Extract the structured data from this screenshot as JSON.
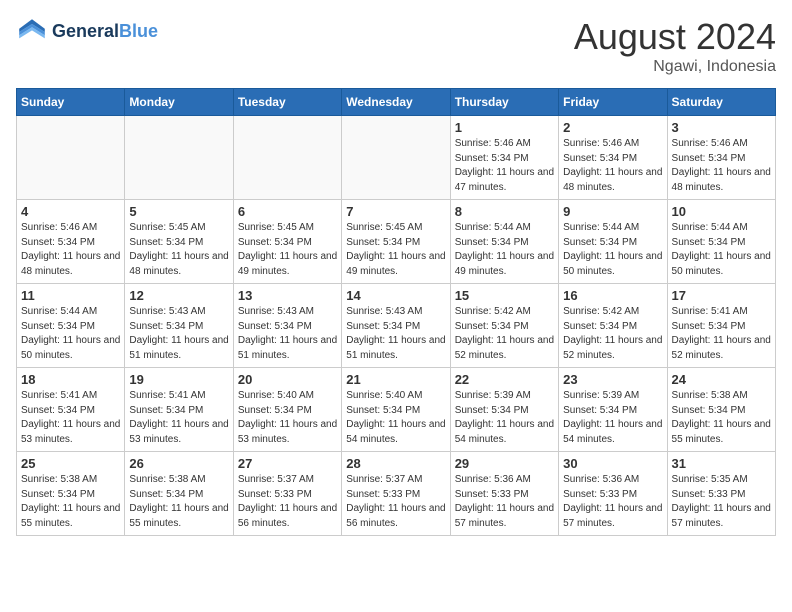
{
  "header": {
    "logo_line1": "General",
    "logo_line2": "Blue",
    "month_year": "August 2024",
    "location": "Ngawi, Indonesia"
  },
  "weekdays": [
    "Sunday",
    "Monday",
    "Tuesday",
    "Wednesday",
    "Thursday",
    "Friday",
    "Saturday"
  ],
  "weeks": [
    [
      {
        "day": "",
        "empty": true
      },
      {
        "day": "",
        "empty": true
      },
      {
        "day": "",
        "empty": true
      },
      {
        "day": "",
        "empty": true
      },
      {
        "day": "1",
        "sunrise": "5:46 AM",
        "sunset": "5:34 PM",
        "daylight": "11 hours and 47 minutes."
      },
      {
        "day": "2",
        "sunrise": "5:46 AM",
        "sunset": "5:34 PM",
        "daylight": "11 hours and 48 minutes."
      },
      {
        "day": "3",
        "sunrise": "5:46 AM",
        "sunset": "5:34 PM",
        "daylight": "11 hours and 48 minutes."
      }
    ],
    [
      {
        "day": "4",
        "sunrise": "5:46 AM",
        "sunset": "5:34 PM",
        "daylight": "11 hours and 48 minutes."
      },
      {
        "day": "5",
        "sunrise": "5:45 AM",
        "sunset": "5:34 PM",
        "daylight": "11 hours and 48 minutes."
      },
      {
        "day": "6",
        "sunrise": "5:45 AM",
        "sunset": "5:34 PM",
        "daylight": "11 hours and 49 minutes."
      },
      {
        "day": "7",
        "sunrise": "5:45 AM",
        "sunset": "5:34 PM",
        "daylight": "11 hours and 49 minutes."
      },
      {
        "day": "8",
        "sunrise": "5:44 AM",
        "sunset": "5:34 PM",
        "daylight": "11 hours and 49 minutes."
      },
      {
        "day": "9",
        "sunrise": "5:44 AM",
        "sunset": "5:34 PM",
        "daylight": "11 hours and 50 minutes."
      },
      {
        "day": "10",
        "sunrise": "5:44 AM",
        "sunset": "5:34 PM",
        "daylight": "11 hours and 50 minutes."
      }
    ],
    [
      {
        "day": "11",
        "sunrise": "5:44 AM",
        "sunset": "5:34 PM",
        "daylight": "11 hours and 50 minutes."
      },
      {
        "day": "12",
        "sunrise": "5:43 AM",
        "sunset": "5:34 PM",
        "daylight": "11 hours and 51 minutes."
      },
      {
        "day": "13",
        "sunrise": "5:43 AM",
        "sunset": "5:34 PM",
        "daylight": "11 hours and 51 minutes."
      },
      {
        "day": "14",
        "sunrise": "5:43 AM",
        "sunset": "5:34 PM",
        "daylight": "11 hours and 51 minutes."
      },
      {
        "day": "15",
        "sunrise": "5:42 AM",
        "sunset": "5:34 PM",
        "daylight": "11 hours and 52 minutes."
      },
      {
        "day": "16",
        "sunrise": "5:42 AM",
        "sunset": "5:34 PM",
        "daylight": "11 hours and 52 minutes."
      },
      {
        "day": "17",
        "sunrise": "5:41 AM",
        "sunset": "5:34 PM",
        "daylight": "11 hours and 52 minutes."
      }
    ],
    [
      {
        "day": "18",
        "sunrise": "5:41 AM",
        "sunset": "5:34 PM",
        "daylight": "11 hours and 53 minutes."
      },
      {
        "day": "19",
        "sunrise": "5:41 AM",
        "sunset": "5:34 PM",
        "daylight": "11 hours and 53 minutes."
      },
      {
        "day": "20",
        "sunrise": "5:40 AM",
        "sunset": "5:34 PM",
        "daylight": "11 hours and 53 minutes."
      },
      {
        "day": "21",
        "sunrise": "5:40 AM",
        "sunset": "5:34 PM",
        "daylight": "11 hours and 54 minutes."
      },
      {
        "day": "22",
        "sunrise": "5:39 AM",
        "sunset": "5:34 PM",
        "daylight": "11 hours and 54 minutes."
      },
      {
        "day": "23",
        "sunrise": "5:39 AM",
        "sunset": "5:34 PM",
        "daylight": "11 hours and 54 minutes."
      },
      {
        "day": "24",
        "sunrise": "5:38 AM",
        "sunset": "5:34 PM",
        "daylight": "11 hours and 55 minutes."
      }
    ],
    [
      {
        "day": "25",
        "sunrise": "5:38 AM",
        "sunset": "5:34 PM",
        "daylight": "11 hours and 55 minutes."
      },
      {
        "day": "26",
        "sunrise": "5:38 AM",
        "sunset": "5:34 PM",
        "daylight": "11 hours and 55 minutes."
      },
      {
        "day": "27",
        "sunrise": "5:37 AM",
        "sunset": "5:33 PM",
        "daylight": "11 hours and 56 minutes."
      },
      {
        "day": "28",
        "sunrise": "5:37 AM",
        "sunset": "5:33 PM",
        "daylight": "11 hours and 56 minutes."
      },
      {
        "day": "29",
        "sunrise": "5:36 AM",
        "sunset": "5:33 PM",
        "daylight": "11 hours and 57 minutes."
      },
      {
        "day": "30",
        "sunrise": "5:36 AM",
        "sunset": "5:33 PM",
        "daylight": "11 hours and 57 minutes."
      },
      {
        "day": "31",
        "sunrise": "5:35 AM",
        "sunset": "5:33 PM",
        "daylight": "11 hours and 57 minutes."
      }
    ]
  ]
}
